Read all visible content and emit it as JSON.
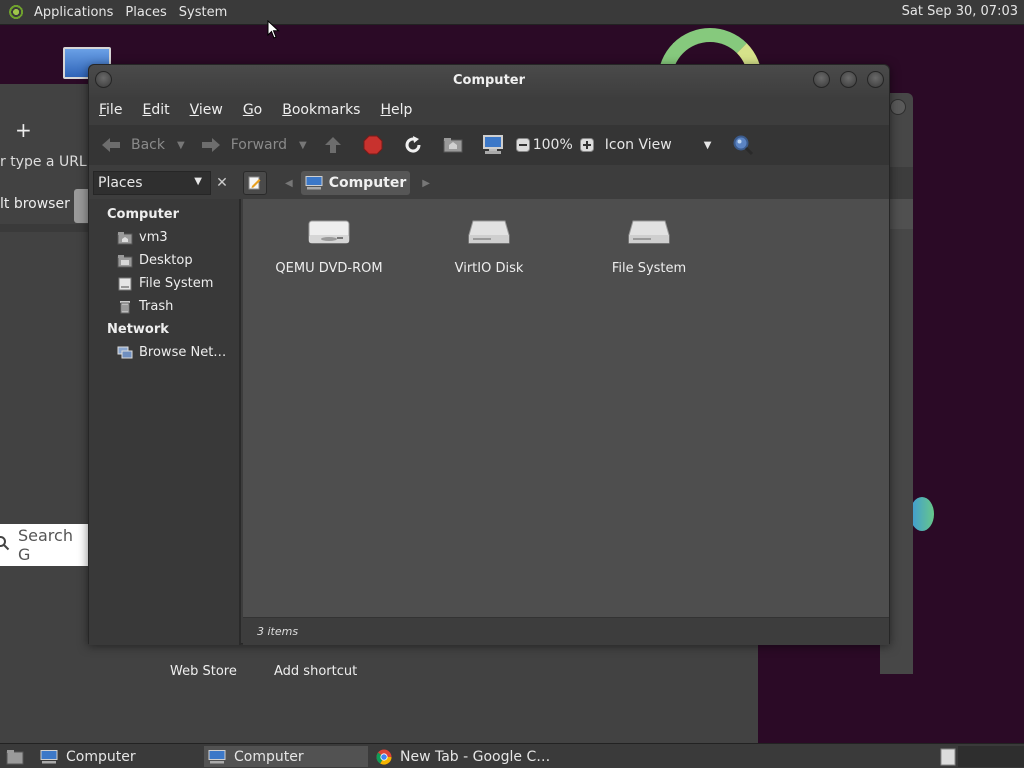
{
  "top_panel": {
    "menus": [
      "Applications",
      "Places",
      "System"
    ],
    "clock": "Sat Sep 30, 07:03"
  },
  "chrome_bg": {
    "plus": "+",
    "url_hint": "r type a URL",
    "default_browser": "lt browser",
    "search_placeholder": "Search G",
    "web_store": "Web Store",
    "add_shortcut": "Add shortcut"
  },
  "window": {
    "title": "Computer",
    "menus": [
      {
        "label": "File",
        "accel": "F",
        "rest": "ile"
      },
      {
        "label": "Edit",
        "accel": "E",
        "rest": "dit"
      },
      {
        "label": "View",
        "accel": "V",
        "rest": "iew"
      },
      {
        "label": "Go",
        "accel": "G",
        "rest": "o"
      },
      {
        "label": "Bookmarks",
        "accel": "B",
        "rest": "ookmarks"
      },
      {
        "label": "Help",
        "accel": "H",
        "rest": "elp"
      }
    ],
    "toolbar": {
      "back": "Back",
      "forward": "Forward",
      "zoom": "100%",
      "view_mode": "Icon View"
    },
    "sidebar_header": "Places",
    "sidebar_close": "✕",
    "pathbar": {
      "crumb": "Computer"
    },
    "sidebar": {
      "computer_label": "Computer",
      "computer_items": [
        "vm3",
        "Desktop",
        "File System",
        "Trash"
      ],
      "network_label": "Network",
      "network_items": [
        "Browse Net…"
      ]
    },
    "files": [
      "QEMU DVD-ROM",
      "VirtIO Disk",
      "File System"
    ],
    "status": "3 items"
  },
  "taskbar": {
    "tasks": [
      "Computer",
      "Computer",
      "New Tab - Google C…"
    ]
  },
  "colors": {
    "desktop": "#2b0a26",
    "panel": "#3a3a3a",
    "content": "#4e4e4e",
    "stop_red": "#c8322e"
  }
}
